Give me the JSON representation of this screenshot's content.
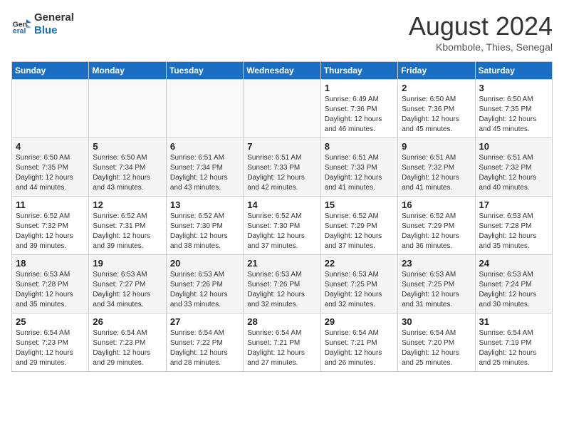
{
  "header": {
    "logo_line1": "General",
    "logo_line2": "Blue",
    "month_title": "August 2024",
    "subtitle": "Kbombole, Thies, Senegal"
  },
  "columns": [
    "Sunday",
    "Monday",
    "Tuesday",
    "Wednesday",
    "Thursday",
    "Friday",
    "Saturday"
  ],
  "weeks": [
    [
      {
        "day": "",
        "info": ""
      },
      {
        "day": "",
        "info": ""
      },
      {
        "day": "",
        "info": ""
      },
      {
        "day": "",
        "info": ""
      },
      {
        "day": "1",
        "info": "Sunrise: 6:49 AM\nSunset: 7:36 PM\nDaylight: 12 hours\nand 46 minutes."
      },
      {
        "day": "2",
        "info": "Sunrise: 6:50 AM\nSunset: 7:36 PM\nDaylight: 12 hours\nand 45 minutes."
      },
      {
        "day": "3",
        "info": "Sunrise: 6:50 AM\nSunset: 7:35 PM\nDaylight: 12 hours\nand 45 minutes."
      }
    ],
    [
      {
        "day": "4",
        "info": "Sunrise: 6:50 AM\nSunset: 7:35 PM\nDaylight: 12 hours\nand 44 minutes."
      },
      {
        "day": "5",
        "info": "Sunrise: 6:50 AM\nSunset: 7:34 PM\nDaylight: 12 hours\nand 43 minutes."
      },
      {
        "day": "6",
        "info": "Sunrise: 6:51 AM\nSunset: 7:34 PM\nDaylight: 12 hours\nand 43 minutes."
      },
      {
        "day": "7",
        "info": "Sunrise: 6:51 AM\nSunset: 7:33 PM\nDaylight: 12 hours\nand 42 minutes."
      },
      {
        "day": "8",
        "info": "Sunrise: 6:51 AM\nSunset: 7:33 PM\nDaylight: 12 hours\nand 41 minutes."
      },
      {
        "day": "9",
        "info": "Sunrise: 6:51 AM\nSunset: 7:32 PM\nDaylight: 12 hours\nand 41 minutes."
      },
      {
        "day": "10",
        "info": "Sunrise: 6:51 AM\nSunset: 7:32 PM\nDaylight: 12 hours\nand 40 minutes."
      }
    ],
    [
      {
        "day": "11",
        "info": "Sunrise: 6:52 AM\nSunset: 7:32 PM\nDaylight: 12 hours\nand 39 minutes."
      },
      {
        "day": "12",
        "info": "Sunrise: 6:52 AM\nSunset: 7:31 PM\nDaylight: 12 hours\nand 39 minutes."
      },
      {
        "day": "13",
        "info": "Sunrise: 6:52 AM\nSunset: 7:30 PM\nDaylight: 12 hours\nand 38 minutes."
      },
      {
        "day": "14",
        "info": "Sunrise: 6:52 AM\nSunset: 7:30 PM\nDaylight: 12 hours\nand 37 minutes."
      },
      {
        "day": "15",
        "info": "Sunrise: 6:52 AM\nSunset: 7:29 PM\nDaylight: 12 hours\nand 37 minutes."
      },
      {
        "day": "16",
        "info": "Sunrise: 6:52 AM\nSunset: 7:29 PM\nDaylight: 12 hours\nand 36 minutes."
      },
      {
        "day": "17",
        "info": "Sunrise: 6:53 AM\nSunset: 7:28 PM\nDaylight: 12 hours\nand 35 minutes."
      }
    ],
    [
      {
        "day": "18",
        "info": "Sunrise: 6:53 AM\nSunset: 7:28 PM\nDaylight: 12 hours\nand 35 minutes."
      },
      {
        "day": "19",
        "info": "Sunrise: 6:53 AM\nSunset: 7:27 PM\nDaylight: 12 hours\nand 34 minutes."
      },
      {
        "day": "20",
        "info": "Sunrise: 6:53 AM\nSunset: 7:26 PM\nDaylight: 12 hours\nand 33 minutes."
      },
      {
        "day": "21",
        "info": "Sunrise: 6:53 AM\nSunset: 7:26 PM\nDaylight: 12 hours\nand 32 minutes."
      },
      {
        "day": "22",
        "info": "Sunrise: 6:53 AM\nSunset: 7:25 PM\nDaylight: 12 hours\nand 32 minutes."
      },
      {
        "day": "23",
        "info": "Sunrise: 6:53 AM\nSunset: 7:25 PM\nDaylight: 12 hours\nand 31 minutes."
      },
      {
        "day": "24",
        "info": "Sunrise: 6:53 AM\nSunset: 7:24 PM\nDaylight: 12 hours\nand 30 minutes."
      }
    ],
    [
      {
        "day": "25",
        "info": "Sunrise: 6:54 AM\nSunset: 7:23 PM\nDaylight: 12 hours\nand 29 minutes."
      },
      {
        "day": "26",
        "info": "Sunrise: 6:54 AM\nSunset: 7:23 PM\nDaylight: 12 hours\nand 29 minutes."
      },
      {
        "day": "27",
        "info": "Sunrise: 6:54 AM\nSunset: 7:22 PM\nDaylight: 12 hours\nand 28 minutes."
      },
      {
        "day": "28",
        "info": "Sunrise: 6:54 AM\nSunset: 7:21 PM\nDaylight: 12 hours\nand 27 minutes."
      },
      {
        "day": "29",
        "info": "Sunrise: 6:54 AM\nSunset: 7:21 PM\nDaylight: 12 hours\nand 26 minutes."
      },
      {
        "day": "30",
        "info": "Sunrise: 6:54 AM\nSunset: 7:20 PM\nDaylight: 12 hours\nand 25 minutes."
      },
      {
        "day": "31",
        "info": "Sunrise: 6:54 AM\nSunset: 7:19 PM\nDaylight: 12 hours\nand 25 minutes."
      }
    ]
  ]
}
